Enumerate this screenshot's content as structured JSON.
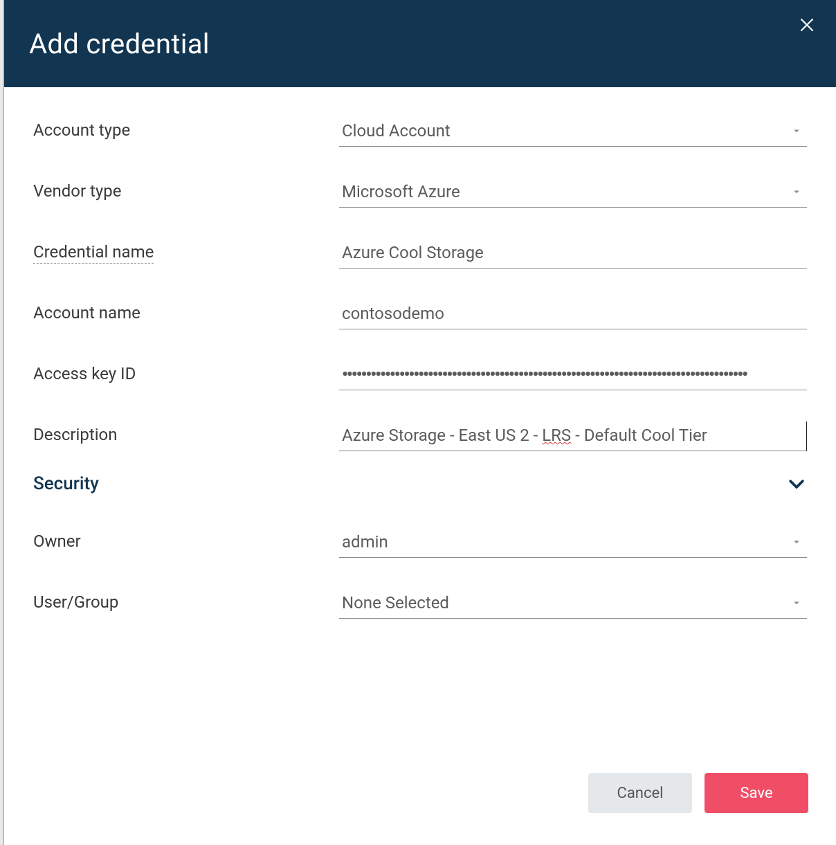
{
  "modal": {
    "title": "Add credential"
  },
  "form": {
    "account_type": {
      "label": "Account type",
      "value": "Cloud Account"
    },
    "vendor_type": {
      "label": "Vendor type",
      "value": "Microsoft Azure"
    },
    "credential_name": {
      "label": "Credential name",
      "value": "Azure Cool Storage"
    },
    "account_name": {
      "label": "Account name",
      "value": "contosodemo"
    },
    "access_key_id": {
      "label": "Access key ID",
      "value": "•••••••••••••••••••••••••••••••••••••••••••••••••••••••••••••••••••••••••••••••••••••"
    },
    "description": {
      "label": "Description",
      "prefix": "Azure Storage - East US 2 - ",
      "spell": "LRS",
      "suffix": " - Default Cool Tier"
    }
  },
  "security": {
    "title": "Security",
    "owner": {
      "label": "Owner",
      "value": "admin"
    },
    "user_group": {
      "label": "User/Group",
      "value": "None Selected"
    }
  },
  "footer": {
    "cancel": "Cancel",
    "save": "Save"
  }
}
